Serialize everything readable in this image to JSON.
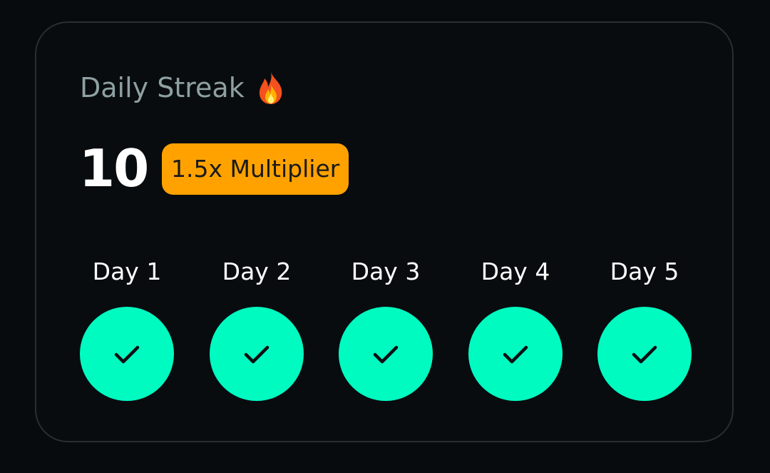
{
  "streak": {
    "title": "Daily Streak",
    "title_icon": "fire-icon",
    "count": "10",
    "multiplier_label": "1.5x Multiplier",
    "colors": {
      "badge": "#ffa200",
      "completed": "#00fbc1",
      "title": "#8fa0a2"
    },
    "days": [
      {
        "label": "Day 1",
        "status": "completed",
        "icon": "check-icon"
      },
      {
        "label": "Day 2",
        "status": "completed",
        "icon": "check-icon"
      },
      {
        "label": "Day 3",
        "status": "completed",
        "icon": "check-icon"
      },
      {
        "label": "Day 4",
        "status": "completed",
        "icon": "check-icon"
      },
      {
        "label": "Day 5",
        "status": "completed",
        "icon": "check-icon"
      }
    ]
  }
}
